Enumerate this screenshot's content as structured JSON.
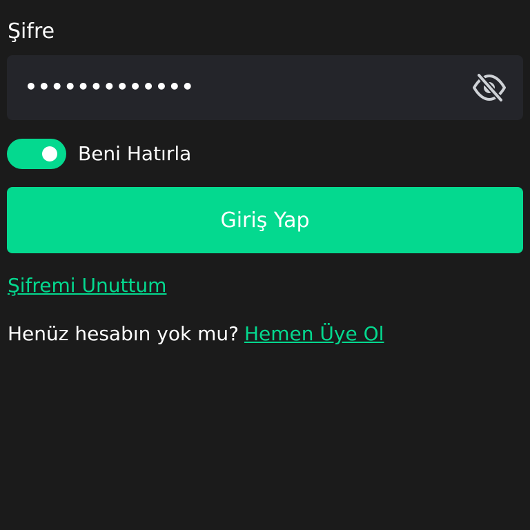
{
  "password_field": {
    "label": "Şifre",
    "value": "•••••••••••••",
    "visibility_icon": "eye-off-icon"
  },
  "remember_me": {
    "label": "Beni Hatırla",
    "enabled": true
  },
  "login_button": {
    "label": "Giriş Yap"
  },
  "forgot_password": {
    "label": "Şifremi Unuttum"
  },
  "signup": {
    "prompt": "Henüz hesabın yok mu?",
    "link_label": "Hemen Üye Ol"
  },
  "colors": {
    "background": "#1b1b1b",
    "input_background": "#24252a",
    "accent": "#04d98f",
    "text": "#ffffff",
    "icon": "#cfd2d6"
  }
}
